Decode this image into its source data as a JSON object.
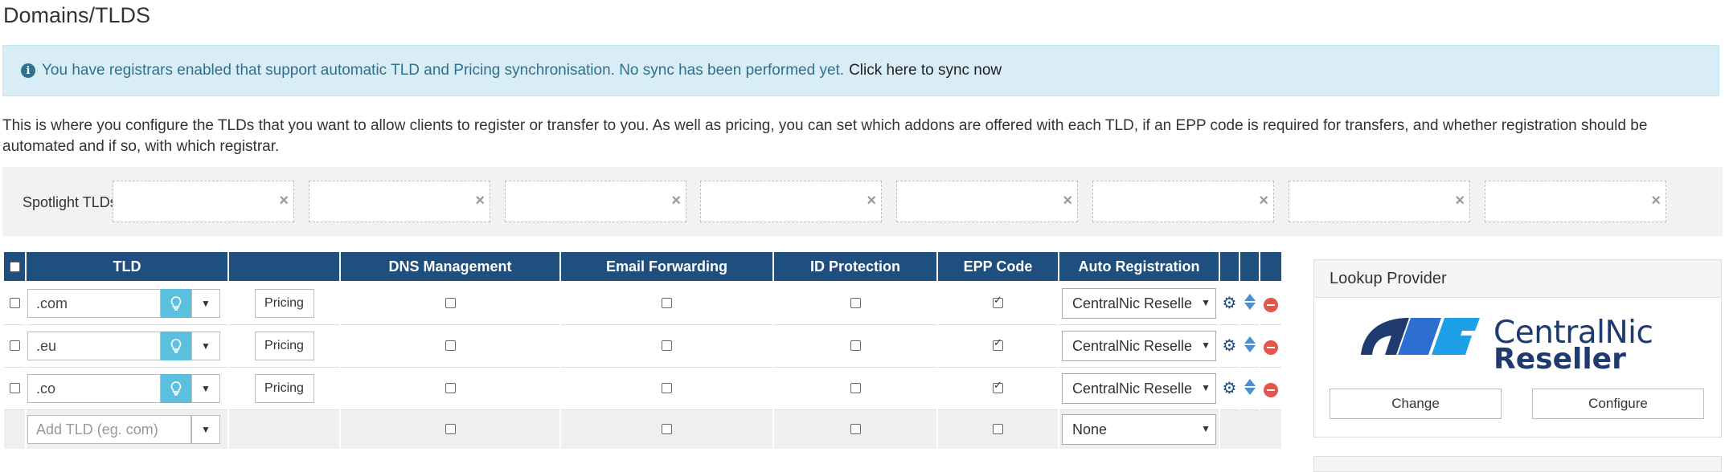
{
  "page": {
    "title": "Domains/TLDS"
  },
  "alert": {
    "message": "You have registrars enabled that support automatic TLD and Pricing synchronisation. No sync has been performed yet.",
    "link": "Click here to sync now",
    "icon": "info-circle-icon"
  },
  "intro": "This is where you configure the TLDs that you want to allow clients to register or transfer to you. As well as pricing, you can set which addons are offered with each TLD, if an EPP code is required for transfers, and whether registration should be automated and if so, with which registrar.",
  "spotlight": {
    "label": "Spotlight TLDs",
    "icon": "lightbulb-outline-icon",
    "slot_count": 8,
    "clear_glyph": "×"
  },
  "table": {
    "headers": {
      "tld": "TLD",
      "dns": "DNS Management",
      "email": "Email Forwarding",
      "id_protection": "ID Protection",
      "epp": "EPP Code",
      "auto_reg": "Auto Registration"
    },
    "pricing_label": "Pricing",
    "rows": [
      {
        "tld": ".com",
        "dns": false,
        "email": false,
        "id_protection": false,
        "epp": true,
        "registrar": "CentralNic Reseller"
      },
      {
        "tld": ".eu",
        "dns": false,
        "email": false,
        "id_protection": false,
        "epp": true,
        "registrar": "CentralNic Reseller"
      },
      {
        "tld": ".co",
        "dns": false,
        "email": false,
        "id_protection": false,
        "epp": true,
        "registrar": "CentralNic Reseller"
      }
    ],
    "add_row": {
      "placeholder": "Add TLD (eg. com)",
      "dns": false,
      "email": false,
      "id_protection": false,
      "epp": false,
      "registrar": "None"
    }
  },
  "lookup": {
    "title": "Lookup Provider",
    "brand_line1": "CentralNic",
    "brand_line2": "Reseller",
    "change_label": "Change",
    "configure_label": "Configure"
  },
  "colors": {
    "header_blue": "#1e4f7f",
    "alert_bg": "#d9edf7",
    "bulb_btn": "#5bc0de",
    "delete_red": "#e4554b"
  }
}
